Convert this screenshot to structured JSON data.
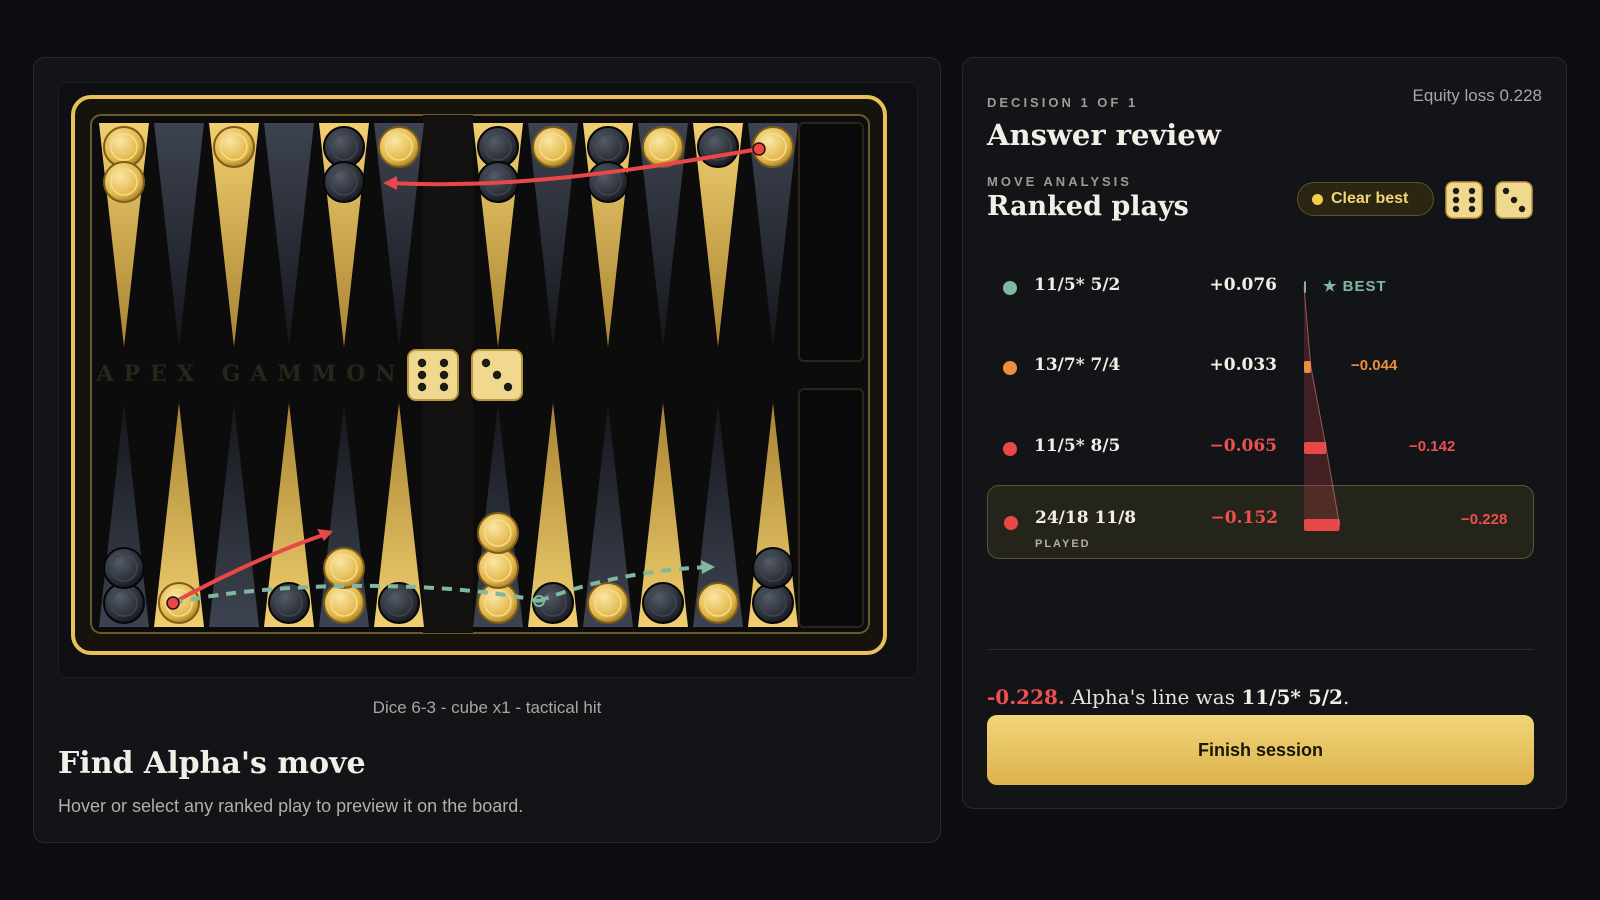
{
  "left_panel": {
    "board_brand": "APEX GAMMON",
    "caption": "Dice 6-3 - cube x1 - tactical hit",
    "title": "Find Alpha's move",
    "subtitle": "Hover or select any ranked play to preview it on the board.",
    "dice": [
      6,
      3
    ]
  },
  "right_panel": {
    "decision_eyebrow": "DECISION 1 OF 1",
    "equity_loss": "Equity loss 0.228",
    "title": "Answer review",
    "analysis_eyebrow": "MOVE ANALYSIS",
    "ranked_title": "Ranked plays",
    "pill_label": "Clear best",
    "dice": [
      6,
      3
    ]
  },
  "plays": [
    {
      "move": "11/5* 5/2",
      "equity": "+0.076",
      "tag": "★ BEST",
      "loss": 0,
      "color": "#7fb89f",
      "played": false,
      "sub": ""
    },
    {
      "move": "13/7* 7/4",
      "equity": "+0.033",
      "tag": "−0.044",
      "loss": 0.044,
      "color": "#eb8f3a",
      "played": false,
      "sub": ""
    },
    {
      "move": "11/5* 8/5",
      "equity": "−0.065",
      "tag": "−0.142",
      "loss": 0.142,
      "color": "#e84848",
      "played": false,
      "sub": ""
    },
    {
      "move": "24/18 11/8",
      "equity": "−0.152",
      "tag": "−0.228",
      "loss": 0.228,
      "color": "#e84848",
      "played": true,
      "sub": "PLAYED"
    }
  ],
  "summary": {
    "loss": "-0.228.",
    "text": " Alpha's line was ",
    "best": "11/5* 5/2",
    "end": "."
  },
  "finish_label": "Finish session",
  "colors": {
    "gold": "#e8c15a",
    "accent_best": "#7fb89f",
    "accent_warn": "#eb8f3a",
    "accent_bad": "#e84848",
    "background": "#0c0e12"
  },
  "board": {
    "top": [
      {
        "color": "light",
        "count": 2
      },
      {
        "color": "",
        "count": 0
      },
      {
        "color": "light",
        "count": 1
      },
      {
        "color": "",
        "count": 0
      },
      {
        "color": "dark",
        "count": 2
      },
      {
        "color": "light",
        "count": 1
      },
      {
        "color": "dark",
        "count": 2
      },
      {
        "color": "light",
        "count": 1
      },
      {
        "color": "dark",
        "count": 2
      },
      {
        "color": "light",
        "count": 1
      },
      {
        "color": "dark",
        "count": 1
      },
      {
        "color": "light",
        "count": 1
      }
    ],
    "bottom": [
      {
        "color": "dark",
        "count": 2
      },
      {
        "color": "light",
        "count": 1
      },
      {
        "color": "",
        "count": 0
      },
      {
        "color": "dark",
        "count": 1
      },
      {
        "color": "light",
        "count": 2
      },
      {
        "color": "dark",
        "count": 1
      },
      {
        "color": "light",
        "count": 3
      },
      {
        "color": "dark",
        "count": 1
      },
      {
        "color": "light",
        "count": 1
      },
      {
        "color": "dark",
        "count": 1
      },
      {
        "color": "light",
        "count": 1
      },
      {
        "color": "dark",
        "count": 2
      }
    ]
  }
}
